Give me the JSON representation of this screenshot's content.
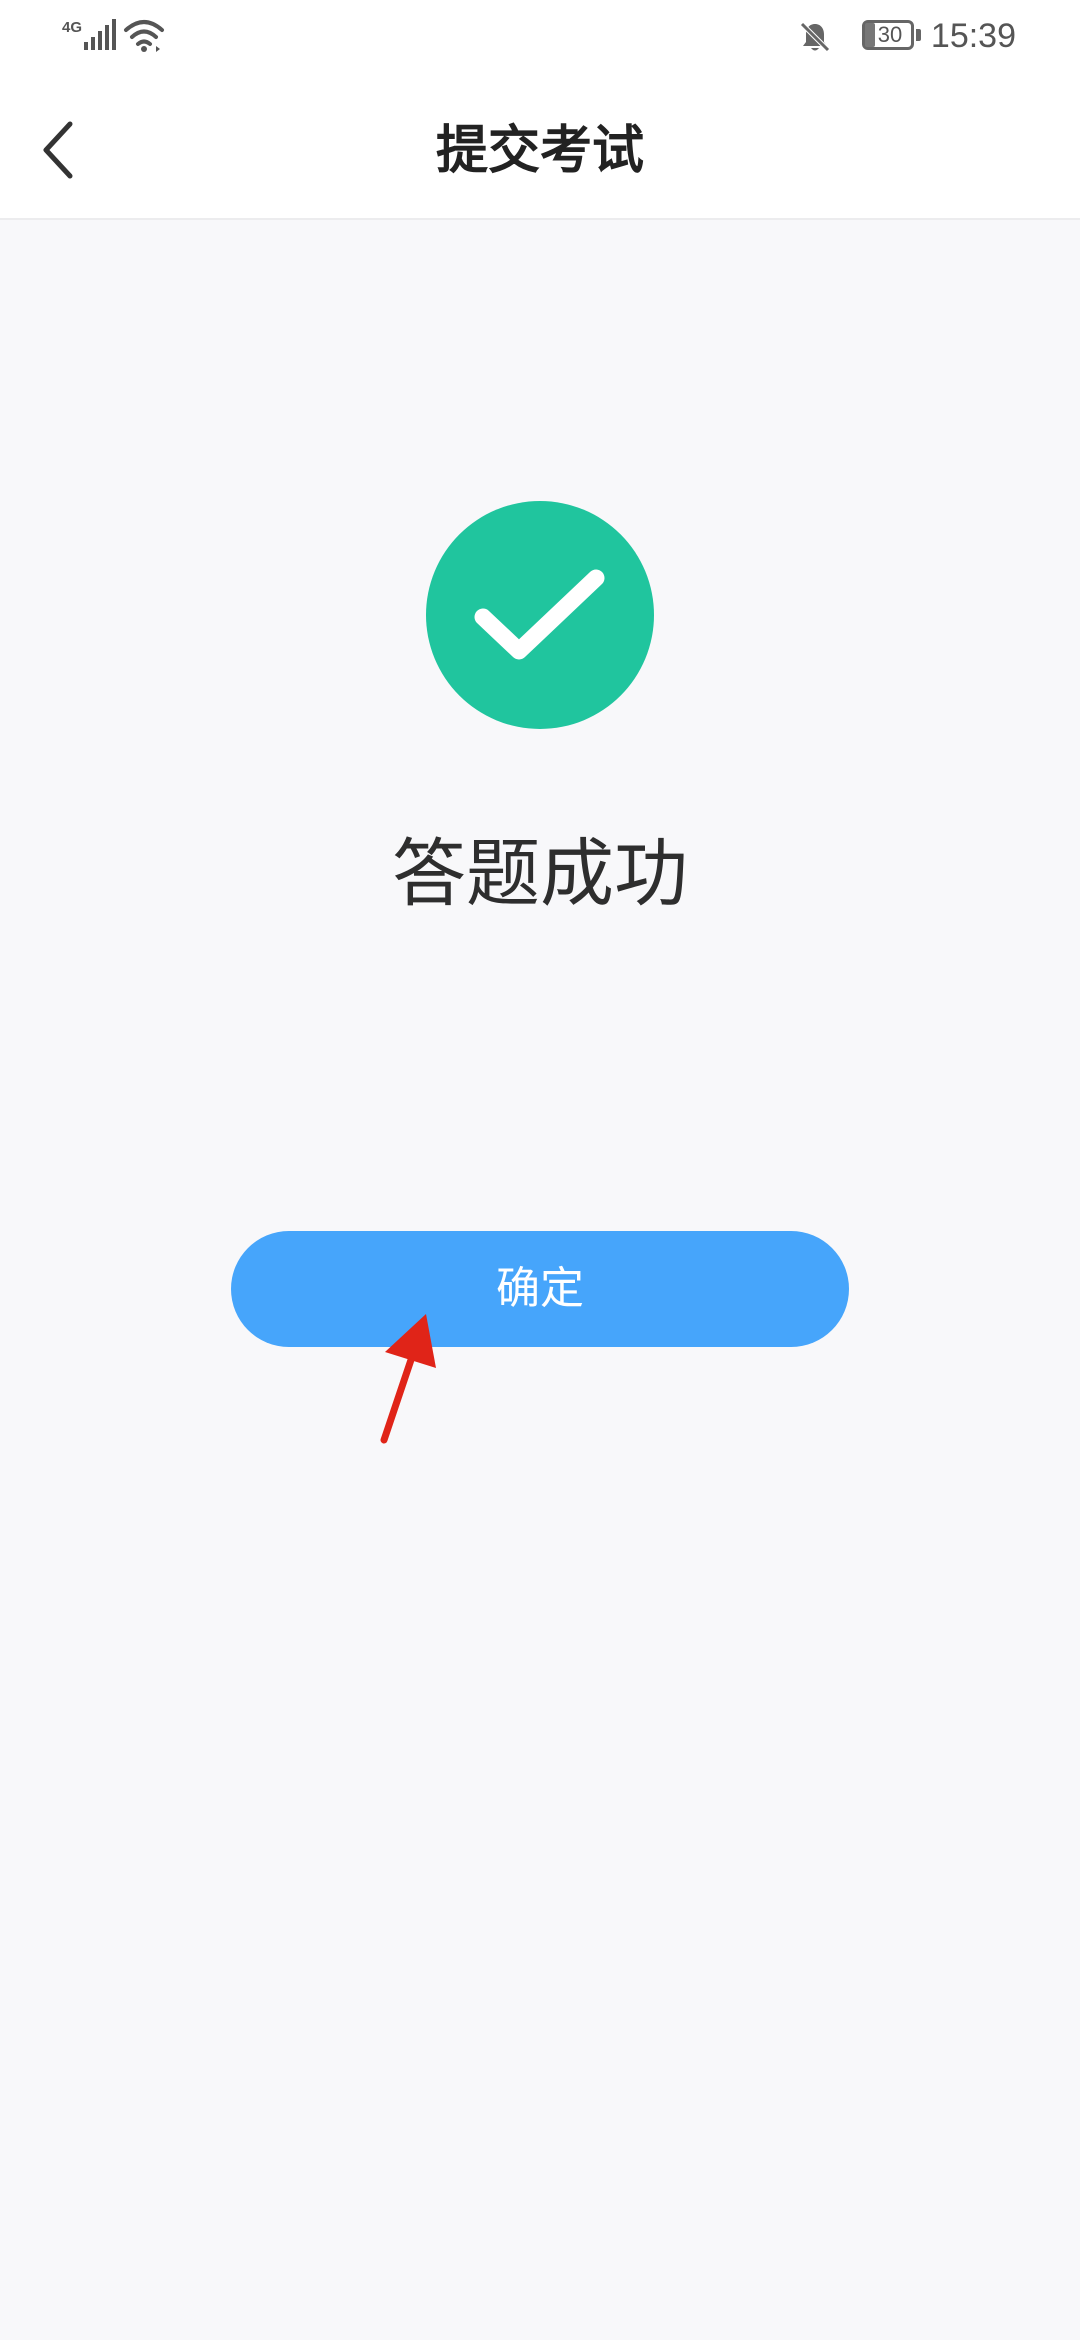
{
  "status_bar": {
    "network": "4G",
    "battery_level": "30",
    "time": "15:39",
    "icons": [
      "signal-4g-icon",
      "wifi-icon",
      "mute-bell-icon",
      "battery-icon"
    ]
  },
  "app_bar": {
    "title": "提交考试",
    "back_icon": "chevron-left-icon"
  },
  "result": {
    "icon": "check-circle-icon",
    "message": "答题成功"
  },
  "actions": {
    "confirm_label": "确定"
  },
  "colors": {
    "success": "#20c59e",
    "primary_button": "#46a5fb",
    "annotation_arrow": "#e02418",
    "background": "#f8f8fa"
  }
}
